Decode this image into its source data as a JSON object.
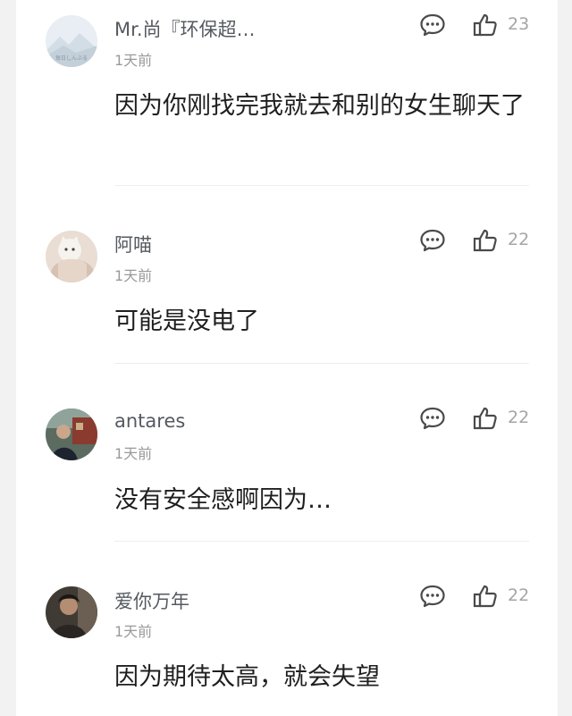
{
  "comments": [
    {
      "username": "Mr.尚『环保超…",
      "time": "1天前",
      "likes": "23",
      "content": "因为你刚找完我就去和别的女生聊天了",
      "avatar_text": "毎日しんぶる",
      "avatar_icon": "mountain-landscape-avatar"
    },
    {
      "username": "阿喵",
      "time": "1天前",
      "likes": "22",
      "content": "可能是没电了",
      "avatar_icon": "cat-photo-avatar"
    },
    {
      "username": "antares",
      "time": "1天前",
      "likes": "22",
      "content": "没有安全感啊因为…",
      "avatar_icon": "person-photo-avatar"
    },
    {
      "username": "爱你万年",
      "time": "1天前",
      "likes": "22",
      "content": "因为期待太高，就会失望",
      "avatar_icon": "portrait-photo-avatar"
    }
  ],
  "icons": {
    "reply": "comment-bubble-icon",
    "like": "thumbs-up-icon"
  },
  "colors": {
    "username": "#555a60",
    "content": "#1f1f1f",
    "meta": "#9a9a9a",
    "icon": "#4a4a4a"
  }
}
